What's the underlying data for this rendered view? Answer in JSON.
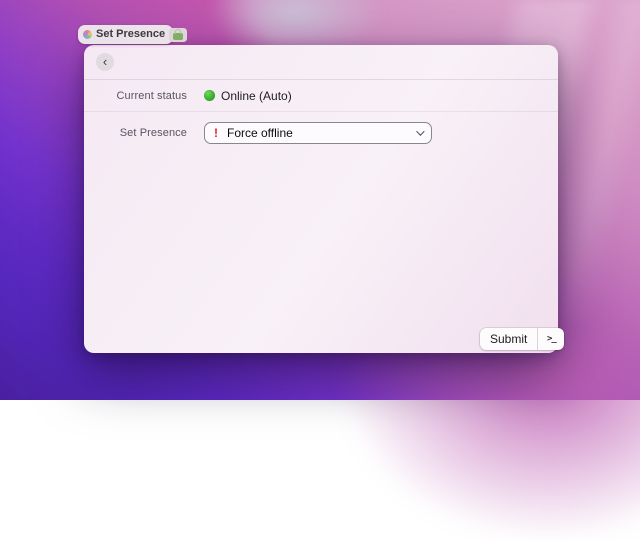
{
  "tab": {
    "title": "Set Presence"
  },
  "window": {
    "back_glyph": "‹",
    "form": {
      "current_status": {
        "label": "Current status",
        "value": "Online (Auto)"
      },
      "set_presence": {
        "label": "Set Presence",
        "selected_option": "Force offline",
        "warning_glyph": "!"
      }
    },
    "footer": {
      "submit_label": "Submit",
      "terminal_glyph": ">_"
    }
  },
  "colors": {
    "status_online_green": "#3bb232",
    "warning_red": "#d9252b",
    "window_background": "#f6ecf4",
    "wallpaper_deep_purple": "#4c20a8",
    "wallpaper_violet": "#7433cc",
    "wallpaper_magenta": "#c557ac",
    "wallpaper_pink": "#d79cc8",
    "wallpaper_lavender": "#c9c3d8"
  }
}
